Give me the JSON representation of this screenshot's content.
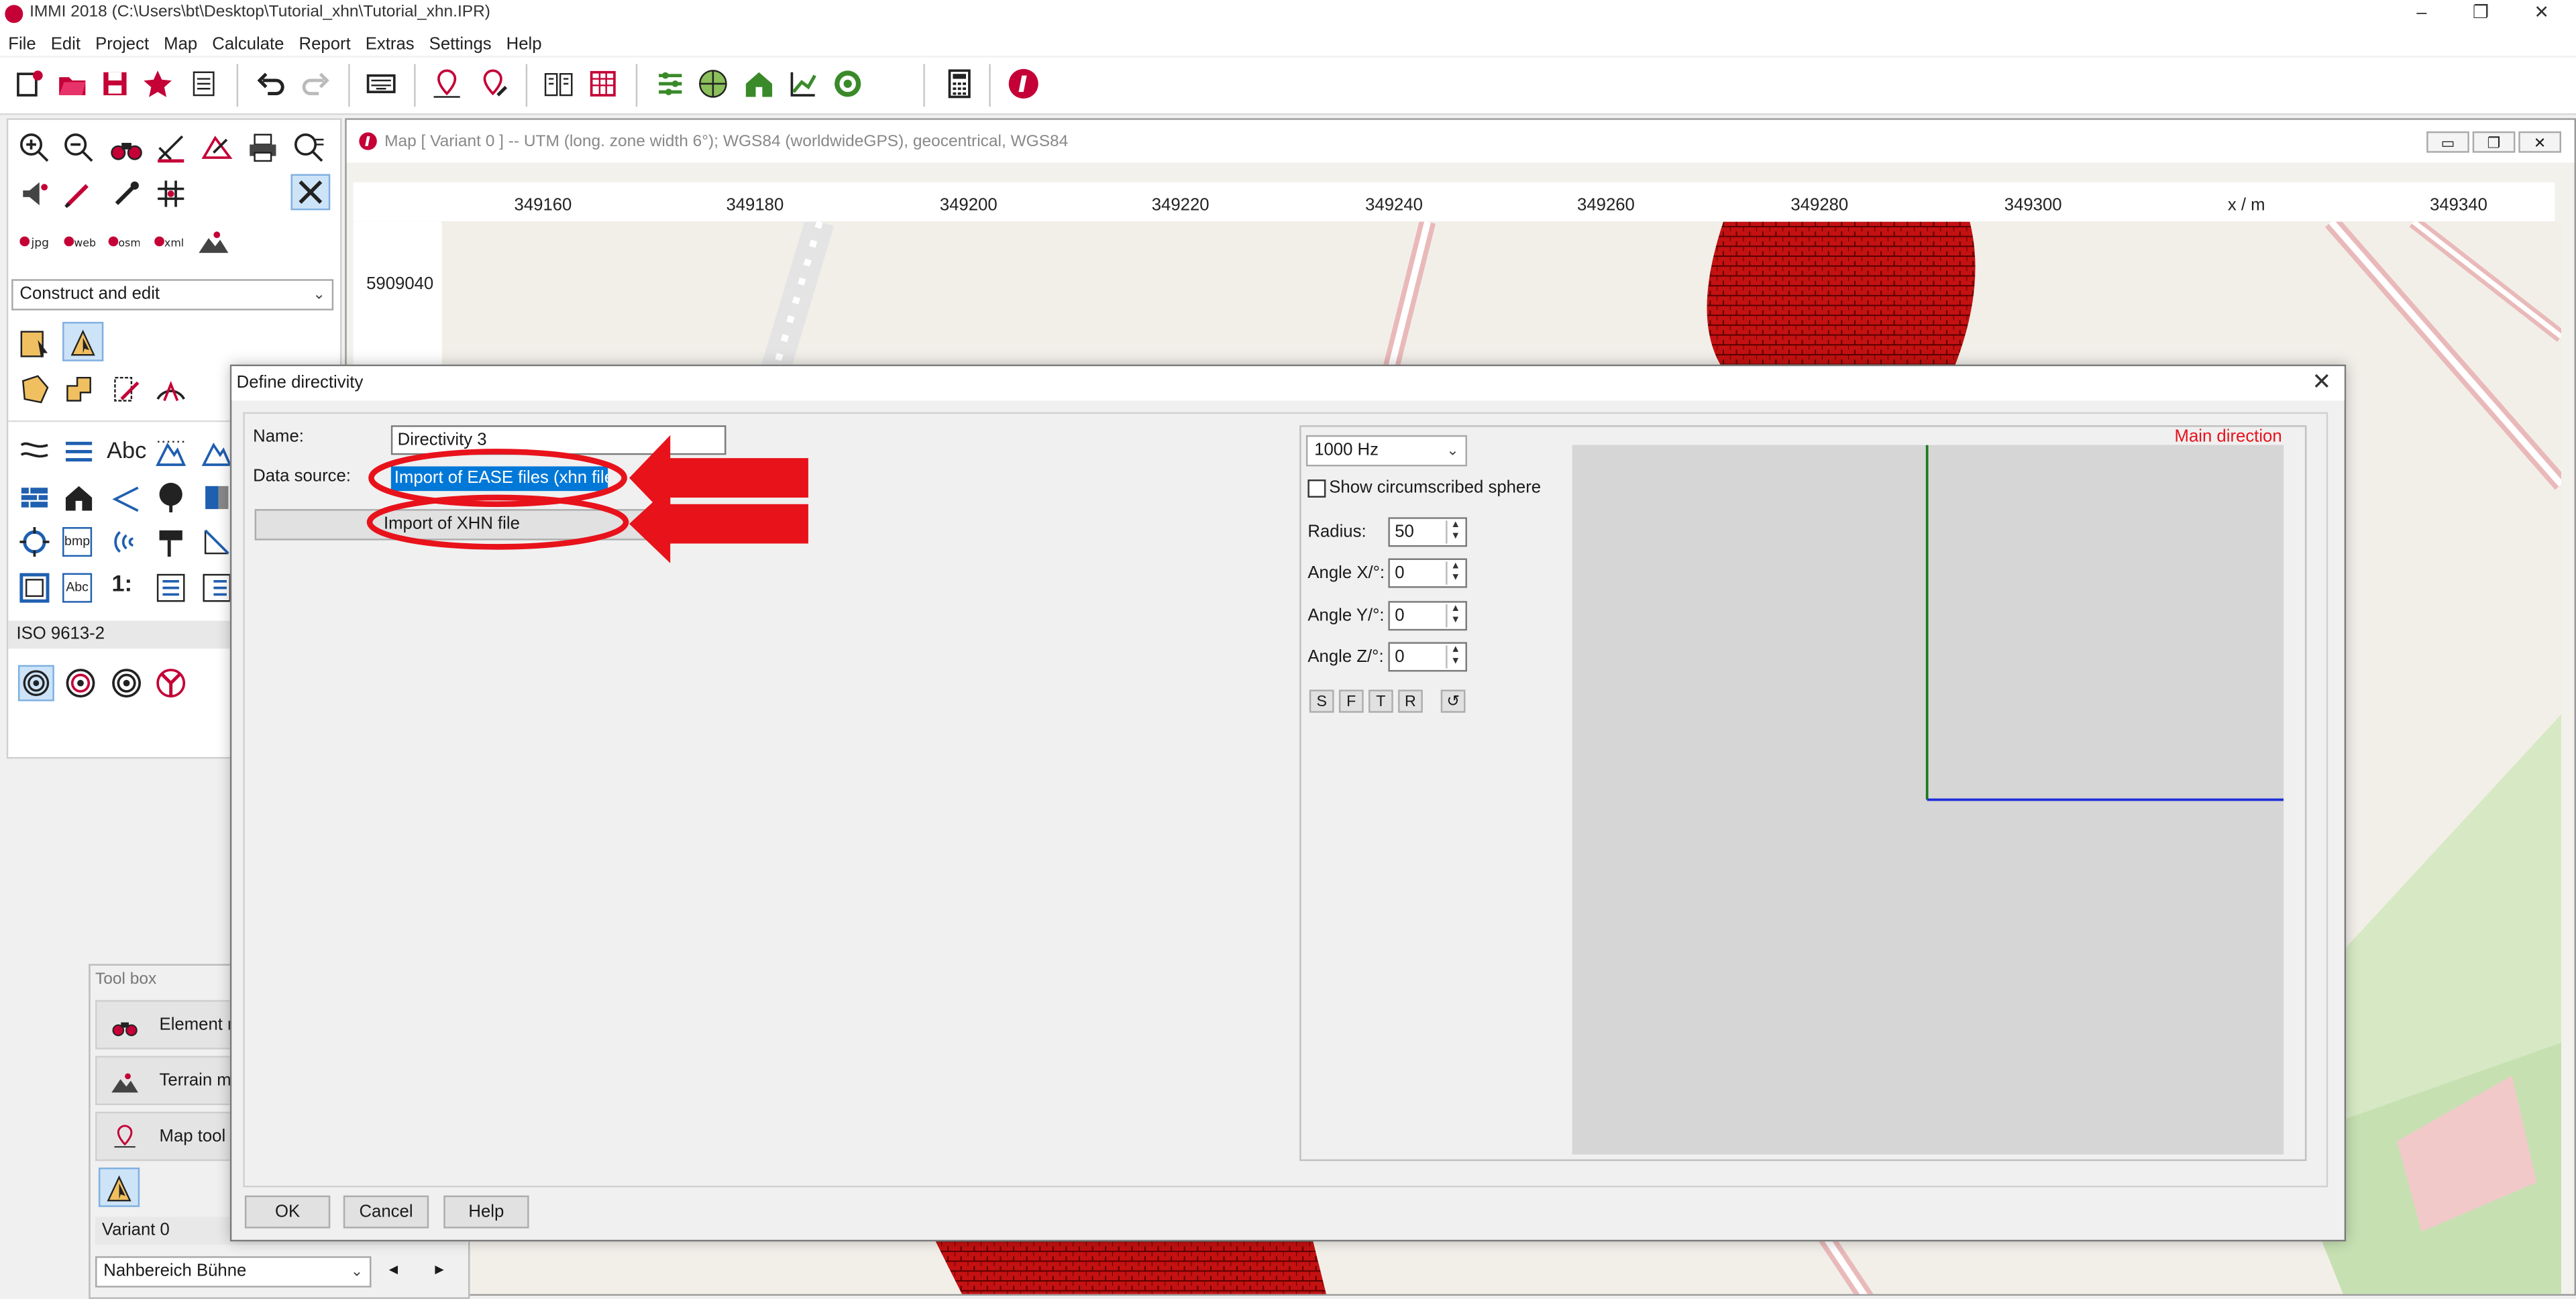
{
  "app": {
    "window_title": "IMMI 2018 (C:\\Users\\bt\\Desktop\\Tutorial_xhn\\Tutorial_xhn.IPR)",
    "window_controls": [
      "–",
      "❐",
      "✕"
    ]
  },
  "menu": [
    "File",
    "Edit",
    "Project",
    "Map",
    "Calculate",
    "Report",
    "Extras",
    "Settings",
    "Help"
  ],
  "left_panel": {
    "mode_select": "Construct and edit",
    "standard_select": "ISO 9613-2"
  },
  "map": {
    "title": "Map  [ Variant 0 ]  --  UTM (long. zone width 6°); WGS84 (worldwideGPS), geocentrical, WGS84",
    "x_ticks": [
      "349160",
      "349180",
      "349200",
      "349220",
      "349240",
      "349260",
      "349280",
      "349300",
      "x / m",
      "349340"
    ],
    "y_ticks": [
      "5909040"
    ]
  },
  "toolbox": {
    "title": "Tool box",
    "items": [
      "Element r",
      "Terrain mo",
      "Map tool b"
    ],
    "variant": "Variant 0",
    "scene_select": "Nahbereich Bühne",
    "nav_prev": "◄",
    "nav_next": "►"
  },
  "dialog": {
    "title": "Define directivity",
    "close": "✕",
    "name_label": "Name:",
    "name_value": "Directivity 3",
    "datasource_label": "Data source:",
    "datasource_value": "Import of EASE files (xhn file)",
    "import_button": "Import of XHN file",
    "frequency_select": "1000 Hz",
    "circumscribed_label": "Show circumscribed sphere",
    "circumscribed_checked": false,
    "radius_label": "Radius:",
    "radius_value": "50",
    "angle_x_label": "Angle X/°:",
    "angle_x_value": "0",
    "angle_y_label": "Angle Y/°:",
    "angle_y_value": "0",
    "angle_z_label": "Angle Z/°:",
    "angle_z_value": "0",
    "view_buttons": [
      "S",
      "F",
      "T",
      "R"
    ],
    "reset_view": "↺",
    "main_direction_label": "Main direction",
    "ok_button": "OK",
    "cancel_button": "Cancel",
    "help_button": "Help"
  },
  "colors": {
    "annotation_red": "#e8121b",
    "brand": "#c40036",
    "preview_bg": "#d6d6d6",
    "axis_green": "#1a7a1a",
    "axis_blue": "#1f2fd8",
    "selection_blue": "#0078d7"
  }
}
